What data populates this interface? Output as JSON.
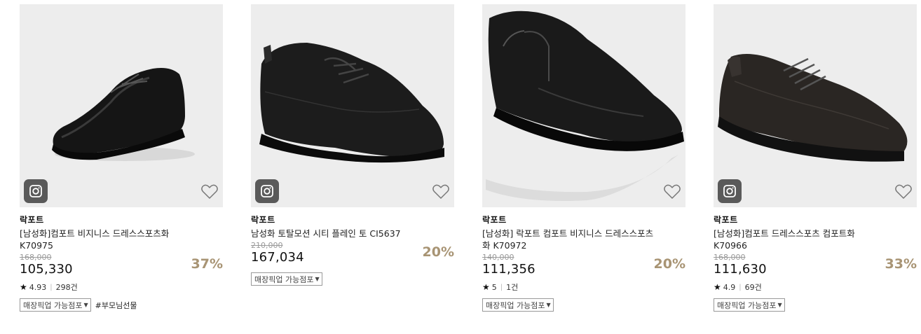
{
  "products": [
    {
      "brand": "락포트",
      "name": "[남성화]컴포트 비지니스 드레스스포츠화 K70975",
      "original_price": "168,000",
      "price": "105,330",
      "discount": "37%",
      "rating": "4.93",
      "reviews": "298건",
      "pickup": "매장픽업 가능점포",
      "hashtag": "#부모님선물",
      "icon": "instagram-icon"
    },
    {
      "brand": "락포트",
      "name": "남성화 토탈모션 시티 플레인 토 CI5637",
      "original_price": "210,000",
      "price": "167,034",
      "discount": "20%",
      "pickup": "매장픽업 가능점포",
      "icon": "instagram-icon"
    },
    {
      "brand": "락포트",
      "name": "[남성화] 락포트 컴포트 비지니스 드레스스포츠화 K70972",
      "original_price": "140,000",
      "price": "111,356",
      "discount": "20%",
      "rating": "5",
      "reviews": "1건",
      "pickup": "매장픽업 가능점포"
    },
    {
      "brand": "락포트",
      "name": "[남성화]컴포트 드레스스포츠 컴포트화 K70966",
      "original_price": "168,000",
      "price": "111,630",
      "discount": "33%",
      "rating": "4.9",
      "reviews": "69건",
      "pickup": "매장픽업 가능점포",
      "icon": "instagram-icon"
    }
  ]
}
